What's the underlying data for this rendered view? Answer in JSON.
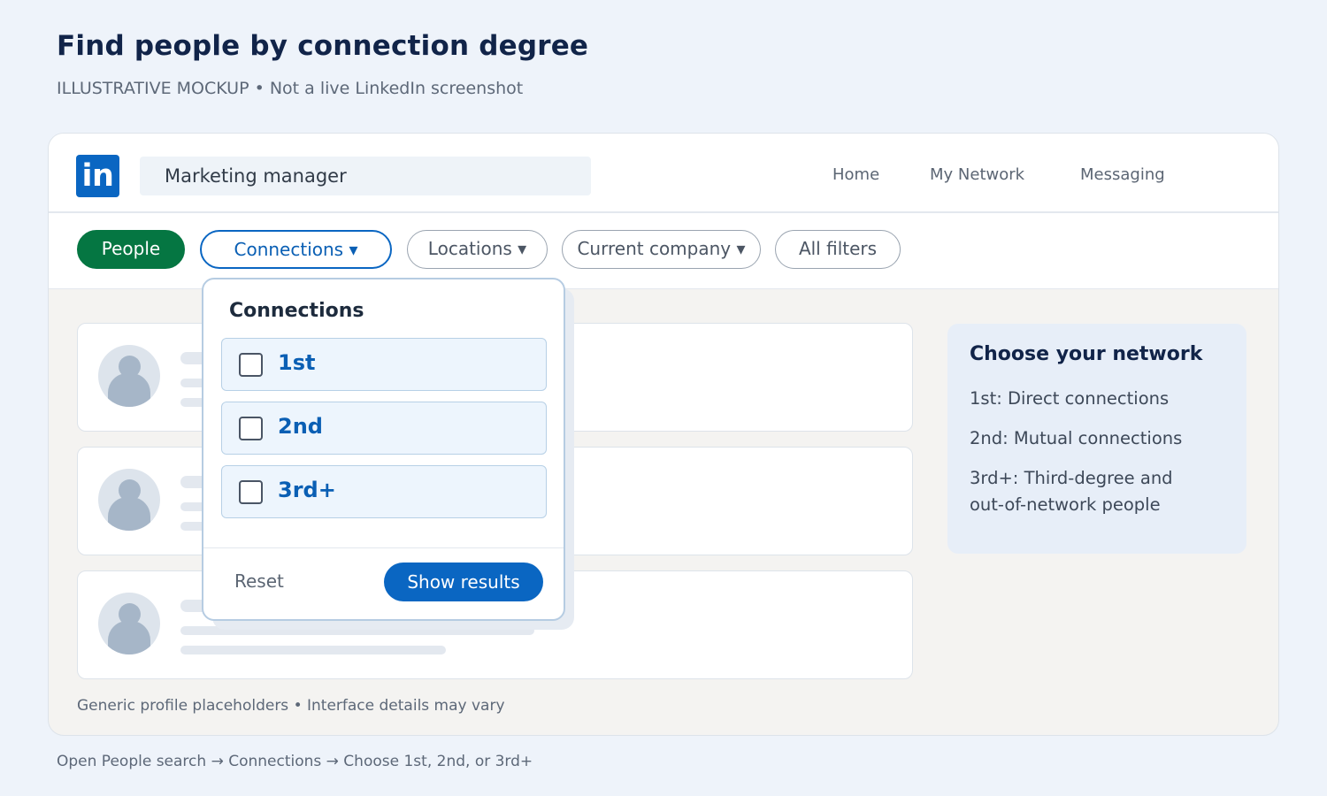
{
  "page": {
    "title": "Find people by connection degree",
    "subtitle": "ILLUSTRATIVE MOCKUP • Not a live LinkedIn screenshot",
    "footer": "Open People search → Connections → Choose 1st, 2nd, or 3rd+"
  },
  "header": {
    "logo": "in",
    "search_value": "Marketing manager",
    "nav": [
      "Home",
      "My Network",
      "Messaging"
    ]
  },
  "filters": {
    "people": "People",
    "connections": "Connections ▾",
    "locations": "Locations ▾",
    "company": "Current company ▾",
    "all": "All filters"
  },
  "dropdown": {
    "title": "Connections",
    "options": [
      "1st",
      "2nd",
      "3rd+"
    ],
    "reset": "Reset",
    "show": "Show results"
  },
  "side_panel": {
    "title": "Choose your network",
    "item1": "1st: Direct connections",
    "item2": "2nd: Mutual connections",
    "item3_line1": "3rd+: Third-degree and",
    "item3_line2": "out-of-network people"
  },
  "results": {
    "note": "Generic profile placeholders • Interface details may vary"
  },
  "colors": {
    "brand_blue": "#0a66c2",
    "people_green": "#057642",
    "title_navy": "#112449"
  }
}
